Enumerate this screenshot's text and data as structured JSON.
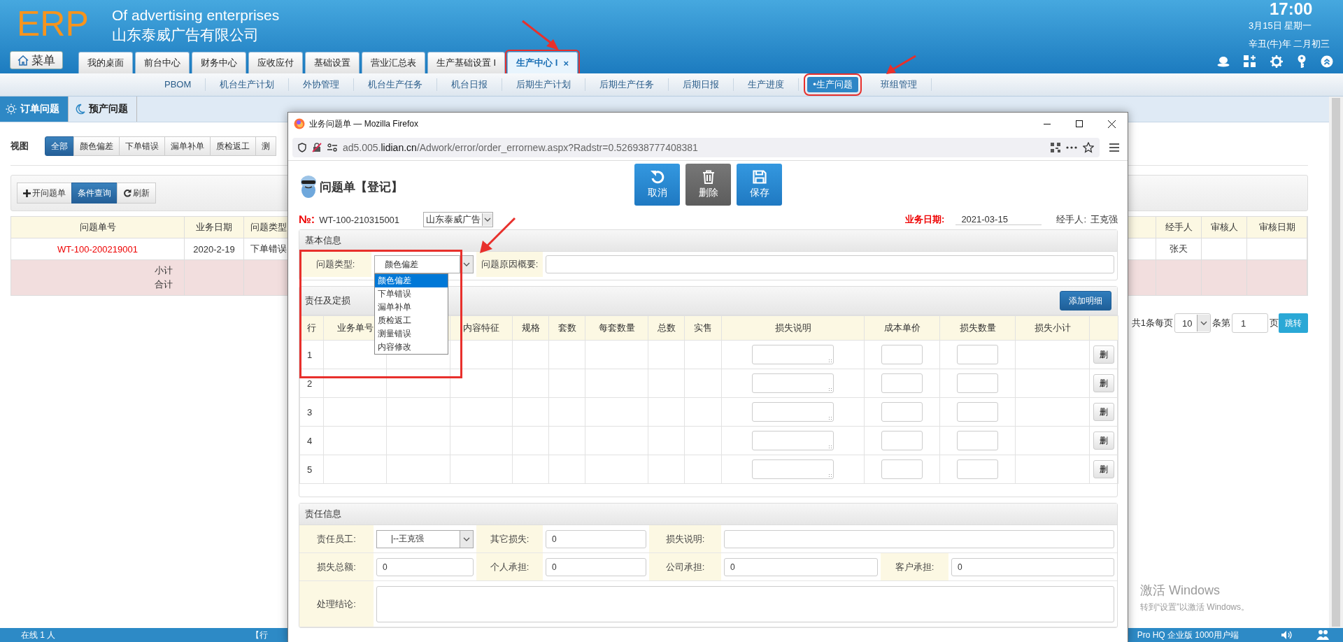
{
  "header": {
    "logo": "ERP",
    "subtitle": "Of advertising enterprises",
    "company": "山东泰威广告有限公司",
    "time": "17:00",
    "date": "3月15日 星期一",
    "lunar": "辛丑(牛)年 二月初三"
  },
  "menu_button": "菜单",
  "module_tabs": [
    {
      "label": "我的桌面",
      "selected": false
    },
    {
      "label": "前台中心",
      "selected": false
    },
    {
      "label": "财务中心",
      "selected": false
    },
    {
      "label": "应收应付",
      "selected": false
    },
    {
      "label": "基础设置",
      "selected": false
    },
    {
      "label": "营业汇总表",
      "selected": false
    },
    {
      "label": "生产基础设置 I",
      "selected": false
    },
    {
      "label": "生产中心 I",
      "selected": true,
      "close": "×"
    }
  ],
  "sub_nav": [
    {
      "label": "PBOM",
      "selected": false
    },
    {
      "label": "机台生产计划",
      "selected": false
    },
    {
      "label": "外协管理",
      "selected": false
    },
    {
      "label": "机台生产任务",
      "selected": false
    },
    {
      "label": "机台日报",
      "selected": false
    },
    {
      "label": "后期生产计划",
      "selected": false
    },
    {
      "label": "后期生产任务",
      "selected": false
    },
    {
      "label": "后期日报",
      "selected": false
    },
    {
      "label": "生产进度",
      "selected": false
    },
    {
      "label": "•生产问题",
      "selected": true
    },
    {
      "label": "班组管理",
      "selected": false
    }
  ],
  "page_tabs": [
    {
      "kind": "sun",
      "label": "订单问题",
      "selected": true
    },
    {
      "kind": "moon",
      "label": "预产问题",
      "selected": false
    }
  ],
  "view_label": "视图",
  "view_filters": [
    {
      "label": "全部",
      "selected": true
    },
    {
      "label": "颜色偏差",
      "selected": false
    },
    {
      "label": "下单错误",
      "selected": false
    },
    {
      "label": "漏单补单",
      "selected": false
    },
    {
      "label": "质检返工",
      "selected": false
    },
    {
      "label": "测",
      "selected": false
    }
  ],
  "toolbar": [
    {
      "kind": "add",
      "label": "开问题单",
      "selected": false
    },
    {
      "kind": "query",
      "label": "条件查询",
      "selected": true
    },
    {
      "kind": "refresh",
      "label": "刷新",
      "selected": false
    }
  ],
  "order_table": {
    "columns_left": [
      "问题单号",
      "业务日期",
      "问题类型"
    ],
    "columns_right": [
      "经手人",
      "审核人",
      "审核日期"
    ],
    "rows": [
      {
        "left": [
          "WT-100-200219001",
          "2020-2-19",
          "下单错误"
        ],
        "right": [
          "张天"
        ]
      }
    ],
    "totals": [
      "小计",
      "合计"
    ]
  },
  "pagination": {
    "prefix": "共1条每页",
    "page_size": "10",
    "middle": "条第",
    "page": "1",
    "suffix": "页",
    "go": "跳转"
  },
  "popup": {
    "title": "业务问题单 — Mozilla Firefox",
    "url": "ad5.005.**lidian.cn**/Adwork/error/order_errornew.aspx?Radstr=0.526938777408381",
    "form_title": "问题单【登记】",
    "actions": [
      {
        "kind": "undo",
        "label": "取消"
      },
      {
        "kind": "delete",
        "label": "删除"
      },
      {
        "kind": "save",
        "label": "保存"
      }
    ],
    "number_label": "№:",
    "number": "WT-100-210315001",
    "company_select": "山东泰威广告",
    "date_label": "业务日期:",
    "date": "2021-03-15",
    "handler_label": "经手人:",
    "handler": "王克强",
    "basic": {
      "title": "基本信息",
      "type_label": "问题类型:",
      "type_value": "颜色偏差",
      "reason_label": "问题原因概要:",
      "options": [
        {
          "label": "颜色偏差",
          "selected": true
        },
        {
          "label": "下单错误",
          "selected": false
        },
        {
          "label": "漏单补单",
          "selected": false
        },
        {
          "label": "质检返工",
          "selected": false
        },
        {
          "label": "测量错误",
          "selected": false
        },
        {
          "label": "内容修改",
          "selected": false
        }
      ]
    },
    "loss": {
      "title": "责任及定损",
      "add_button": "添加明细",
      "columns": [
        {
          "kind": "index",
          "label": "行"
        },
        {
          "kind": "plain",
          "label": "业务单号"
        },
        {
          "kind": "plain"
        },
        {
          "kind": "plain",
          "label": "内容特征"
        },
        {
          "kind": "plain",
          "label": "规格"
        },
        {
          "kind": "plain",
          "label": "套数"
        },
        {
          "kind": "plain",
          "label": "每套数量"
        },
        {
          "kind": "plain",
          "label": "总数"
        },
        {
          "kind": "plain",
          "label": "实售"
        },
        {
          "kind": "note",
          "label": "损失说明"
        },
        {
          "kind": "input",
          "label": "成本单价"
        },
        {
          "kind": "input",
          "label": "损失数量"
        },
        {
          "kind": "plain",
          "label": "损失小计"
        },
        {
          "kind": "action"
        }
      ],
      "rows": [
        {
          "row": "1",
          "delete": "删"
        },
        {
          "row": "2",
          "delete": "删"
        },
        {
          "row": "3",
          "delete": "删"
        },
        {
          "row": "4",
          "delete": "删"
        },
        {
          "row": "5",
          "delete": "删"
        }
      ]
    },
    "responsibility": {
      "title": "责任信息",
      "staff_label": "责任员工:",
      "staff": "|--王克强",
      "other_loss_label": "其它损失:",
      "other_loss": "0",
      "loss_note_label": "损失说明:",
      "total_label": "损失总额:",
      "total": "0",
      "personal_label": "个人承担:",
      "personal": "0",
      "company_label": "公司承担:",
      "company": "0",
      "customer_label": "客户承担:",
      "customer": "0",
      "conclusion_label": "处理结论:"
    }
  },
  "status_bar": {
    "online": "在线  1  人",
    "middle": "【行",
    "edition": "Pro HQ 企业版 1000用户端"
  },
  "windows_notice": {
    "title": "激活 Windows",
    "hint": "转到“设置”以激活 Windows。"
  }
}
